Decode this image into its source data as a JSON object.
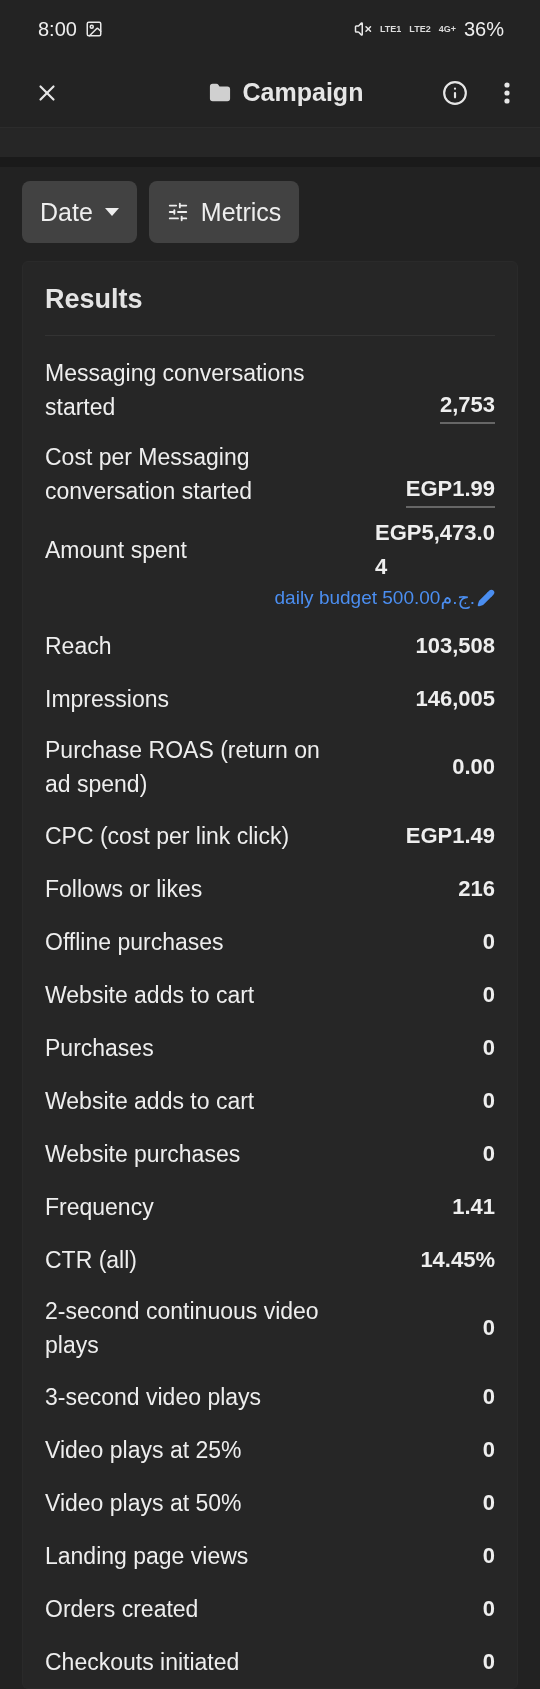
{
  "status_bar": {
    "time": "8:00",
    "network_labels": [
      "LTE1",
      "LTE2",
      "4G+"
    ],
    "battery": "36%"
  },
  "header": {
    "title": "Campaign"
  },
  "filters": [
    {
      "label": "Date",
      "kind": "dropdown"
    },
    {
      "label": "Metrics",
      "kind": "sliders"
    }
  ],
  "results": {
    "title": "Results",
    "rows": [
      {
        "label": "Messaging conversations started",
        "value": "2,753",
        "underlined": true
      },
      {
        "label": "Cost per Messaging conversation started",
        "value": "EGP1.99",
        "underlined": true
      },
      {
        "label": "Amount spent",
        "value": "EGP5,473.04",
        "underlined": false,
        "link": "daily budget 500.00ج.م."
      },
      {
        "label": "Reach",
        "value": "103,508",
        "underlined": false
      },
      {
        "label": "Impressions",
        "value": "146,005",
        "underlined": false
      },
      {
        "label": "Purchase ROAS (return on ad spend)",
        "value": "0.00",
        "underlined": false
      },
      {
        "label": "CPC (cost per link click)",
        "value": "EGP1.49",
        "underlined": false
      },
      {
        "label": "Follows or likes",
        "value": "216",
        "underlined": false
      },
      {
        "label": "Offline purchases",
        "value": "0",
        "underlined": false
      },
      {
        "label": "Website adds to cart",
        "value": "0",
        "underlined": false
      },
      {
        "label": "Purchases",
        "value": "0",
        "underlined": false
      },
      {
        "label": "Website adds to cart",
        "value": "0",
        "underlined": false
      },
      {
        "label": "Website purchases",
        "value": "0",
        "underlined": false
      },
      {
        "label": "Frequency",
        "value": "1.41",
        "underlined": false
      },
      {
        "label": "CTR (all)",
        "value": "14.45%",
        "underlined": false
      },
      {
        "label": "2-second continuous video plays",
        "value": "0",
        "underlined": false
      },
      {
        "label": "3-second video plays",
        "value": "0",
        "underlined": false
      },
      {
        "label": "Video plays at 25%",
        "value": "0",
        "underlined": false
      },
      {
        "label": "Video plays at 50%",
        "value": "0",
        "underlined": false
      },
      {
        "label": "Landing page views",
        "value": "0",
        "underlined": false
      },
      {
        "label": "Orders created",
        "value": "0",
        "underlined": false
      },
      {
        "label": "Checkouts initiated",
        "value": "0",
        "underlined": false
      }
    ]
  }
}
